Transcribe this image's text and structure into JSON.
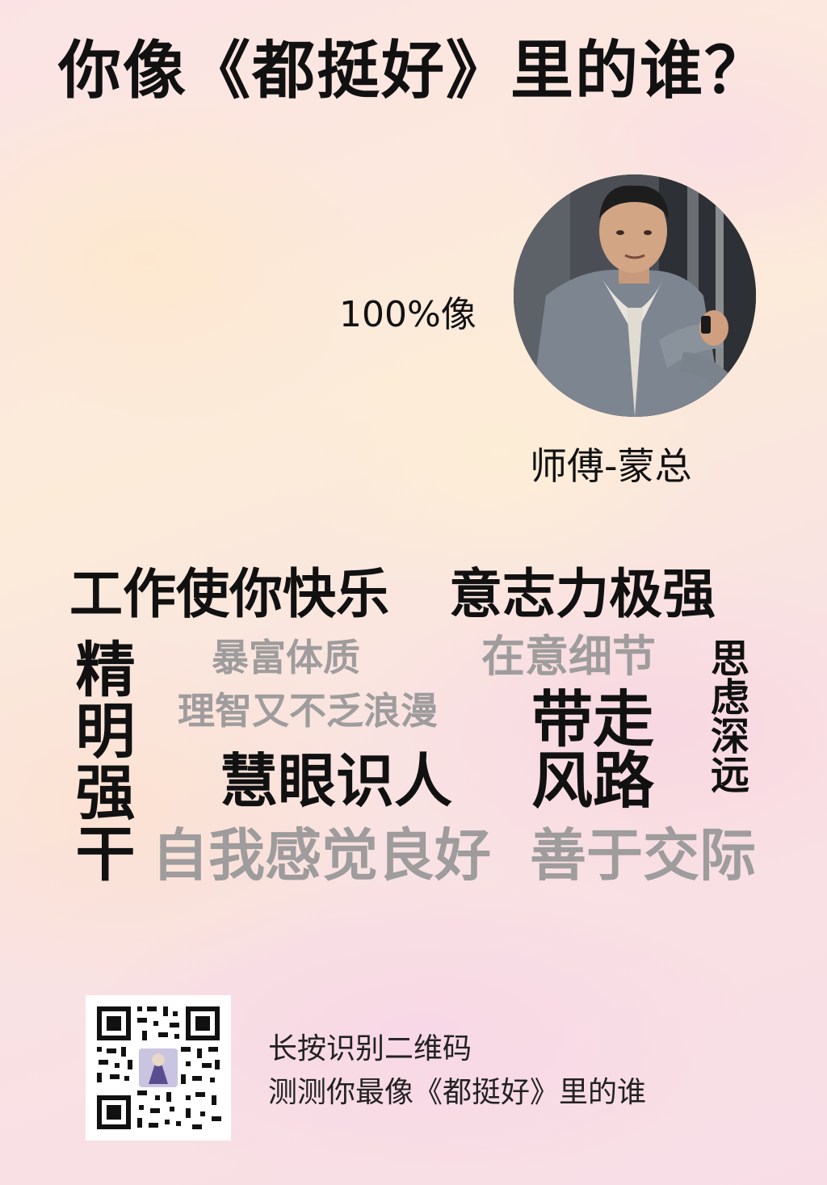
{
  "title": "你像《都挺好》里的谁？",
  "result": {
    "match_label": "100%像",
    "character_name": "师傅-蒙总"
  },
  "traits": {
    "headline_1": "工作使你快乐",
    "headline_2": "意志力极强",
    "vertical_left": "精明强干",
    "gray_1": "暴富体质",
    "gray_2": "在意细节",
    "vertical_right": "思虑深远",
    "gray_3": "理智又不乏浪漫",
    "dark_1": "带走",
    "dark_2": "慧眼识人",
    "dark_3": "风路",
    "gray_bottom_1": "自我感觉良好",
    "gray_bottom_2": "善于交际"
  },
  "footer": {
    "line1": "长按识别二维码",
    "line2": "测测你最像《都挺好》里的谁"
  }
}
